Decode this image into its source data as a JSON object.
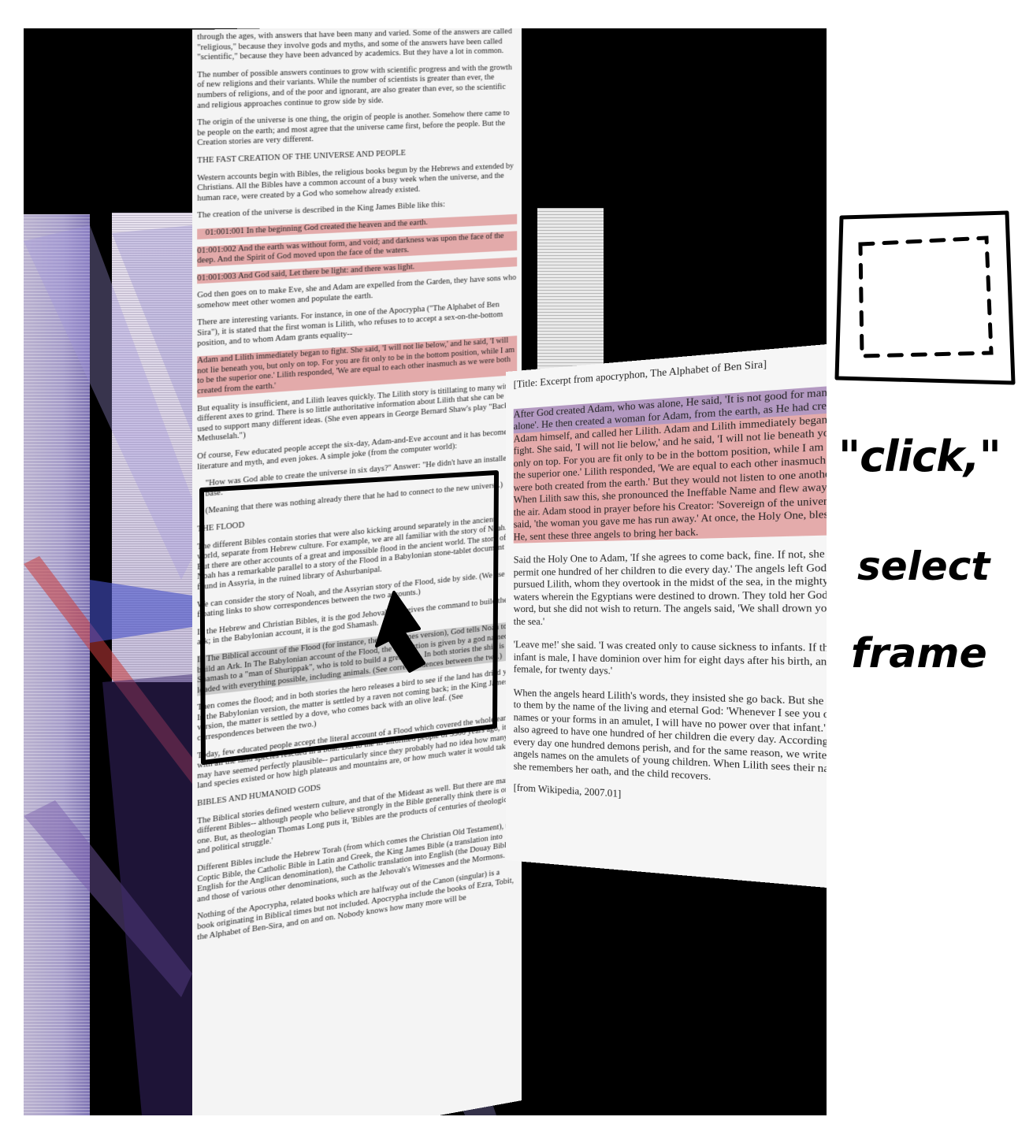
{
  "main_doc": {
    "paragraphs": [
      "through the ages, with answers that have been many and varied. Some of the answers are called \"religious,\" because they involve gods and myths, and some of the answers have been called \"scientific,\" because they have been advanced by academics. But they have a lot in common.",
      "The number of possible answers continues to grow with scientific progress and with the growth of new religions and their variants. While the number of scientists is greater than ever, the numbers of religions, and of the poor and ignorant, are also greater than ever, so the scientific and religious approaches continue to grow side by side.",
      "The origin of the universe is one thing, the origin of people is another. Somehow there came to be people on the earth; and most agree that the universe came first, before the people. But the Creation stories are very different.",
      "THE FAST CREATION OF THE UNIVERSE AND PEOPLE",
      "Western accounts begin with Bibles, the religious books begun by the Hebrews and extended by Christians. All the Bibles have a common account of a busy week when the universe, and the human race, were created by a God who somehow already existed.",
      "The creation of the universe is described in the King James Bible like this:",
      "01:001:001 In the beginning God created the heaven and the earth.",
      "01:001:002 And the earth was without form, and void; and darkness was upon the face of the deep. And the Spirit of God moved upon the face of the waters.",
      "01:001:003 And God said, Let there be light: and there was light.",
      "God then goes on to make Eve, she and Adam are expelled from the Garden, they have sons who somehow meet other women and populate the earth.",
      "There are interesting variants. For instance, in one of the Apocrypha (\"The Alphabet of Ben Sira\"), it is stated that the first woman is Lilith, who refuses to to accept a sex-on-the-bottom position, and to whom Adam grants equality--",
      "Adam and Lilith immediately began to fight. She said, 'I will not lie below,' and he said, 'I will not lie beneath you, but only on top. For you are fit only to be in the bottom position, while I am to be the superior one.' Lilith responded, 'We are equal to each other inasmuch as we were both created from the earth.'",
      "But equality is insufficient, and Lilith leaves quickly. The Lilith story is titillating to many with different axes to grind. There is so little authoritative information about Lilith that she can be used to support many different ideas. (She even appears in George Bernard Shaw's play \"Back to Methuselah.\")",
      "Of course, Few educated people accept the six-day, Adam-and-Eve account and it has become literature and myth, and even jokes. A simple joke (from the computer world):",
      "\"How was God able to create the universe in six days?\" Answer: \"He didn't have an installed base.\"",
      "(Meaning that there was nothing already there that he had to connect to the new universe.)",
      "THE FLOOD",
      "The different Bibles contain stories that were also kicking around separately in the ancient world, separate from Hebrew culture. For example, we are all familiar with the story of Noah. But there are other accounts of a great and impossible flood in the ancient world. The story of Noah has a remarkable parallel to a story of the Flood in a Babylonian stone-tablet document found in Assyria, in the ruined library of Ashurbanipal.",
      "We can consider the story of Noah, and the Assyrian story of the Flood, side by side. (We use floating links to show correspondences between the two accounts.)",
      "In the Hebrew and Christian Bibles, it is the god Jehovah who gives the command to build the ark; in the Babylonian account, it is the god Shamash.",
      "In The Biblical account of the Flood (for instance, the King James version), God tells Noah to build an Ark. In The Babylonian account of the Flood, the instruction is given by a god named Shamash to a \"man of Shurippak\", who is told to build a great ship. In both stories the ship is loaded with everything possible, including animals. (See correspondences between the two.)",
      "Then comes the flood; and in both stories the hero releases a bird to see if the land has dried yet. In the Babylonian version, the matter is settled by a raven not coming back; in the King James version, the matter is settled by a dove, who comes back with an olive leaf. (See correspondences between the two.)",
      "Today, few educated people accept the literal account of a Flood which covered the whole earth, with all the land species rescued in a boat. But to the ill-informed people of 3500 years ago, it may have seemed perfectly plausible-- particularly since they probably had no idea how many land species existed or how high plateaus and mountains are, or how much water it would take.",
      "BIBLES AND HUMANOID GODS",
      "The Biblical stories defined western culture, and that of the Mideast as well. But there are many different Bibles-- although people who believe strongly in the Bible generally think there is only one. But, as theologian Thomas Long puts it, 'Bibles are the products of centuries of theological and political struggle.'",
      "Different Bibles include the Hebrew Torah (from which comes the Christian Old Testament), the Coptic Bible, the Catholic Bible in Latin and Greek, the King James Bible (a translation into English for the Anglican denomination), the Catholic translation into English (the Douay Bible), and those of various other denominations, such as the Jehovah's Witnesses and the Mormons.",
      "Nothing of the Apocrypha, related books which are halfway out of the Canon (singular) is a book originating in Biblical times but not included. Apocrypha include the books of Ezra, Tobit, the Alphabet of Ben-Sira, and on and on. Nobody knows how many more will be"
    ]
  },
  "side_doc": {
    "title": "[Title: Excerpt from apocryphon, The Alphabet of Ben Sira]",
    "paragraphs": [
      "After God created Adam, who was alone, He said, 'It is not good for man to be alone'. He then created a woman for Adam, from the earth, as He had created Adam himself, and called her Lilith. Adam and Lilith immediately began to fight. She said, 'I will not lie below,' and he said, 'I will not lie beneath you, but only on top. For you are fit only to be in the bottom position, while I am to be the superior one.' Lilith responded, 'We are equal to each other inasmuch as we were both created from the earth.' But they would not listen to one another. When Lilith saw this, she pronounced the Ineffable Name and flew away into the air. Adam stood in prayer before his Creator: 'Sovereign of the universe!' he said, 'the woman you gave me has run away.' At once, the Holy One, blessed be He, sent these three angels to bring her back.",
      "Said the Holy One to Adam, 'If she agrees to come back, fine. If not, she must permit one hundred of her children to die every day.' The angels left God and pursued Lilith, whom they overtook in the midst of the sea, in the mighty waters wherein the Egyptians were destined to drown. They told her God's word, but she did not wish to return. The angels said, 'We shall drown you in the sea.'",
      "'Leave me!' she said. 'I was created only to cause sickness to infants. If the infant is male, I have dominion over him for eight days after his birth, and if female, for twenty days.'",
      "When the angels heard Lilith's words, they insisted she go back. But she swore to them by the name of the living and eternal God: 'Whenever I see you or your names or your forms in an amulet, I will have no power over that infant.' She also agreed to have one hundred of her children die every day. Accordingly, every day one hundred demons perish, and for the same reason, we write the angels names on the amulets of young children. When Lilith sees their names, she remembers her oath, and the child recovers."
    ],
    "footer": "[from Wikipedia, 2007.01]"
  },
  "annotations": {
    "click": "\"click,\"",
    "select": "select",
    "frame": "frame"
  }
}
